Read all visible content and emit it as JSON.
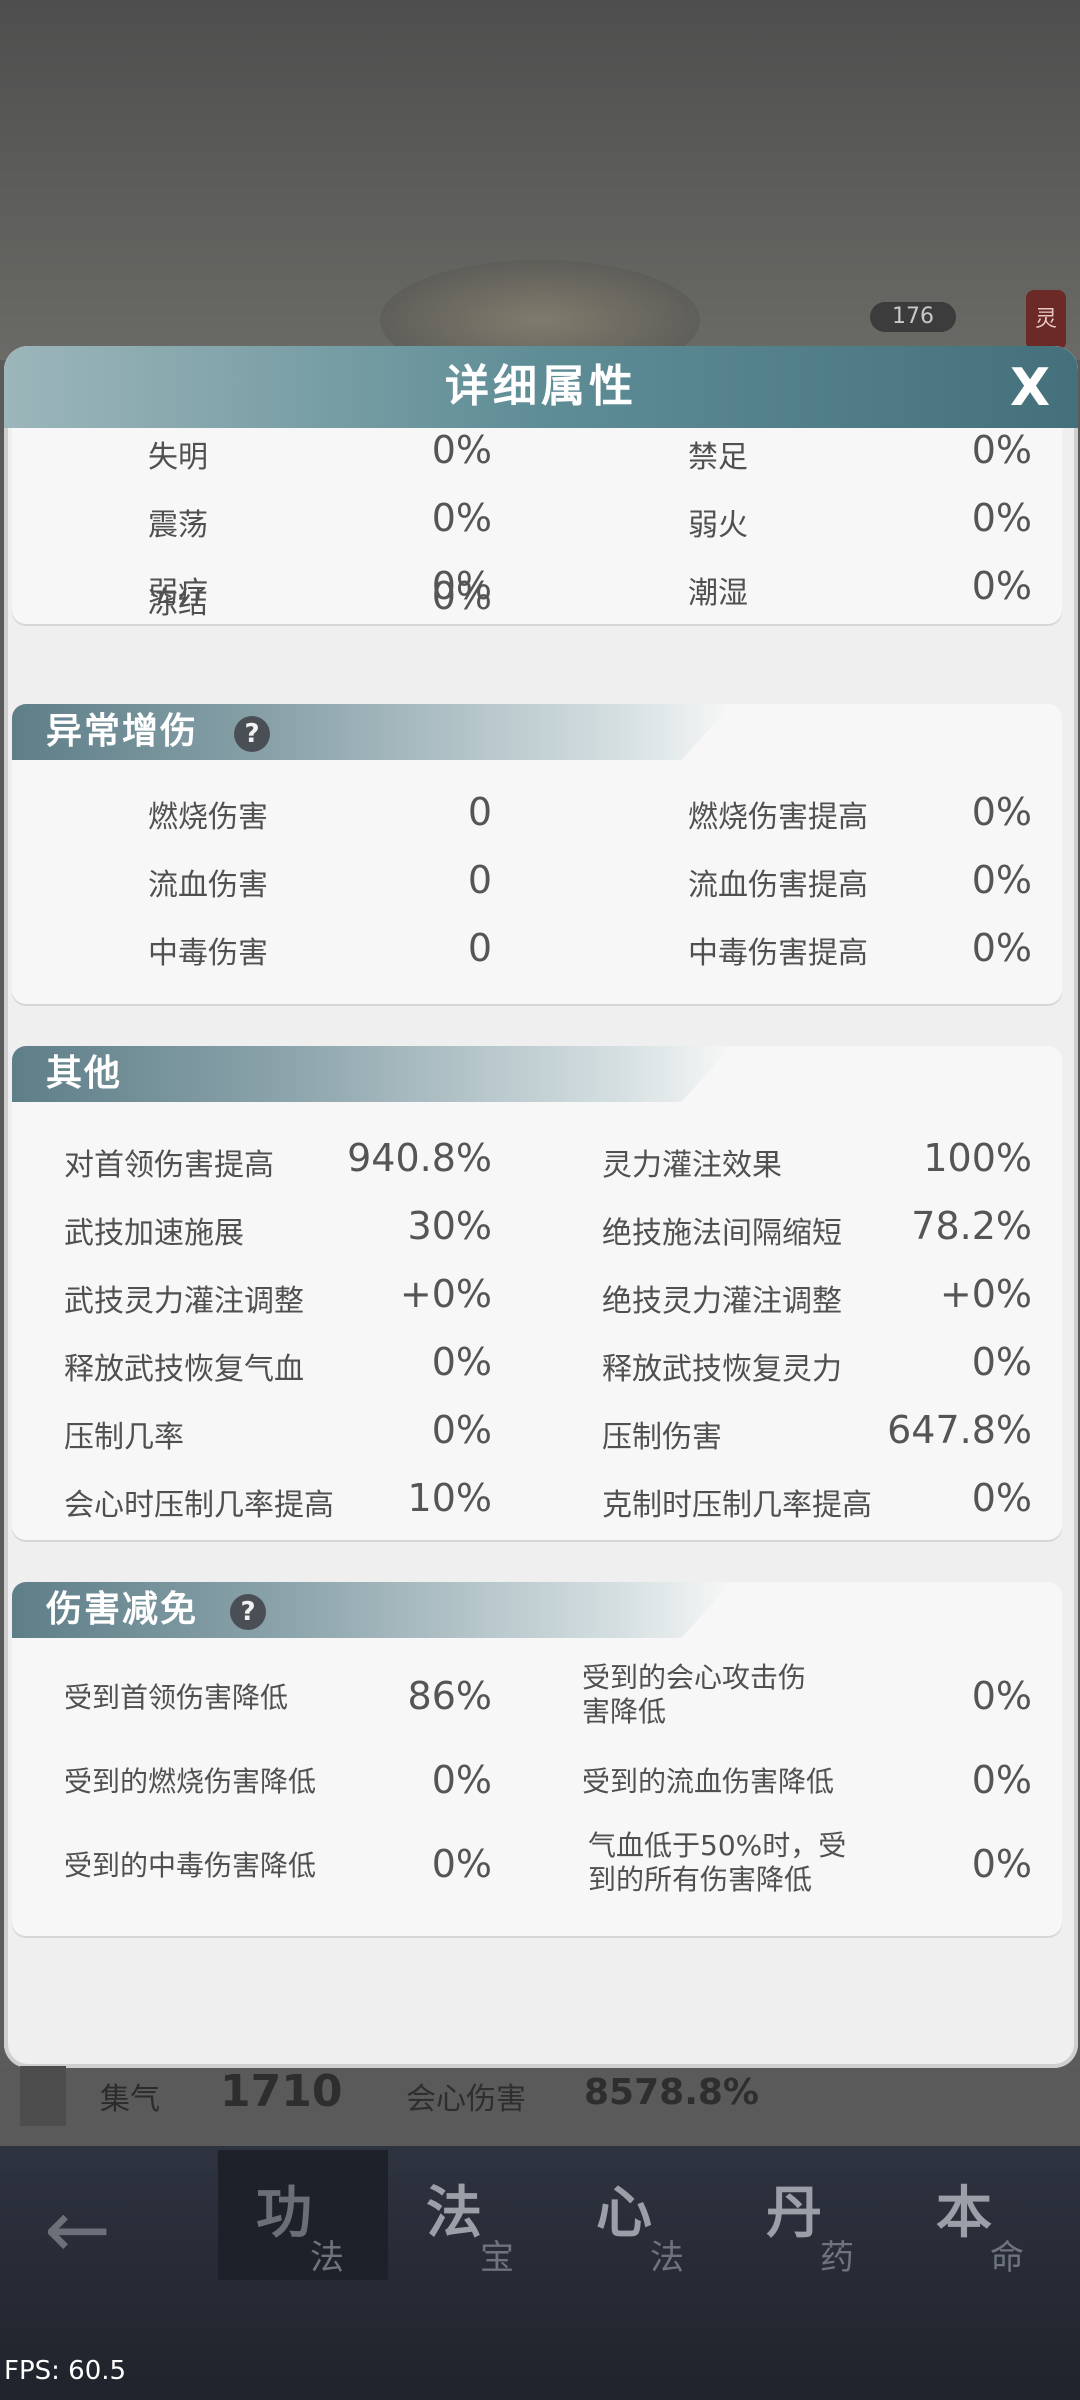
{
  "background": {
    "counter": "176",
    "side_tag": "灵"
  },
  "modal": {
    "title": "详细属性",
    "close_label": "X",
    "resist_card": {
      "rows": [
        {
          "l1": "失明",
          "v1": "0%",
          "l2": "禁足",
          "v2": "0%"
        },
        {
          "l1": "震荡",
          "v1": "0%",
          "l2": "弱火",
          "v2": "0%"
        },
        {
          "l1": "弱疗",
          "v1": "0%",
          "l2": "潮湿",
          "v2": "0%"
        },
        {
          "l1": "冻结",
          "v1": "0%"
        }
      ]
    },
    "abnormal_card": {
      "title": "异常增伤",
      "help": "?",
      "rows": [
        {
          "l1": "燃烧伤害",
          "v1": "0",
          "l2": "燃烧伤害提高",
          "v2": "0%"
        },
        {
          "l1": "流血伤害",
          "v1": "0",
          "l2": "流血伤害提高",
          "v2": "0%"
        },
        {
          "l1": "中毒伤害",
          "v1": "0",
          "l2": "中毒伤害提高",
          "v2": "0%"
        }
      ]
    },
    "other_card": {
      "title": "其他",
      "rows": [
        {
          "l1": "对首领伤害提高",
          "v1": "940.8%",
          "l2": "灵力灌注效果",
          "v2": "100%"
        },
        {
          "l1": "武技加速施展",
          "v1": "30%",
          "l2": "绝技施法间隔缩短",
          "v2": "78.2%"
        },
        {
          "l1": "武技灵力灌注调整",
          "v1": "+0%",
          "l2": "绝技灵力灌注调整",
          "v2": "+0%"
        },
        {
          "l1": "释放武技恢复气血",
          "v1": "0%",
          "l2": "释放武技恢复灵力",
          "v2": "0%"
        },
        {
          "l1": "压制几率",
          "v1": "0%",
          "l2": "压制伤害",
          "v2": "647.8%"
        },
        {
          "l1": "会心时压制几率提高",
          "v1": "10%",
          "l2": "克制时压制几率提高",
          "v2": "0%"
        }
      ]
    },
    "reduce_card": {
      "title": "伤害减免",
      "help": "?",
      "rows": [
        {
          "l1": "受到首领伤害降低",
          "v1": "86%",
          "l2a": "受到的会心攻击伤",
          "l2b": "害降低",
          "v2": "0%"
        },
        {
          "l1": "受到的燃烧伤害降低",
          "v1": "0%",
          "l2a": "受到的流血伤害降低",
          "l2b": "",
          "v2": "0%"
        },
        {
          "l1": "受到的中毒伤害降低",
          "v1": "0%",
          "l2a": "气血低于50%时，受",
          "l2b": "到的所有伤害降低",
          "v2": "0%"
        }
      ]
    }
  },
  "stats_bar": {
    "qi_label": "集气",
    "qi_value": "1710",
    "crit_label": "会心伤害",
    "crit_value": "8578.8%"
  },
  "nav": {
    "back": "←",
    "tabs": [
      {
        "big": "功",
        "small": "法"
      },
      {
        "big": "法",
        "small": "宝"
      },
      {
        "big": "心",
        "small": "法"
      },
      {
        "big": "丹",
        "small": "药"
      },
      {
        "big": "本",
        "small": "命"
      }
    ]
  },
  "fps": "FPS: 60.5"
}
